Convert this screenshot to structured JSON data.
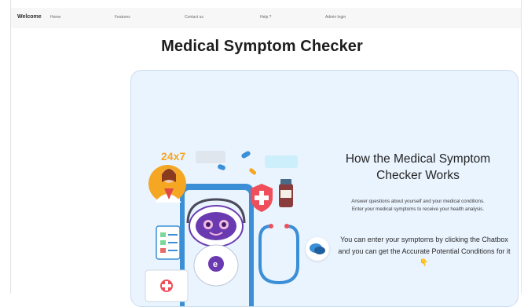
{
  "navbar": {
    "brand": "Welcome",
    "links": [
      "Home",
      "Features",
      "Contact us",
      "Help ?",
      "Admin login"
    ]
  },
  "page": {
    "title": "Medical Symptom Checker"
  },
  "card": {
    "heading": "How the Medical Symptom Checker Works",
    "description_line1": "Answer questions about yourself and your medical conditions.",
    "description_line2": "Enter your medical symptoms to receive your health analysis.",
    "chat_note": "You can enter your symptoms by clicking the Chatbox and you can get the Accurate Potential Conditions for it 👇",
    "illustration_label": "24x7"
  },
  "icons": {
    "chat": "chat-bubble-icon",
    "robot": "robot-doctor-icon",
    "stethoscope": "stethoscope-icon",
    "shield": "medical-shield-icon"
  },
  "colors": {
    "card_bg": "#eaf4ff",
    "accent_orange": "#f5a623",
    "accent_blue": "#3a8fd6",
    "robot_purple": "#6a3bb0"
  }
}
